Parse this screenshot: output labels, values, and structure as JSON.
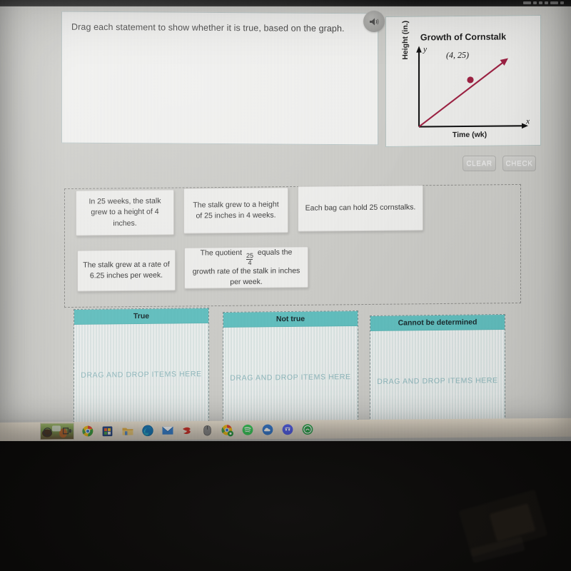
{
  "app": {
    "prompt": "Drag each statement to show whether it is true, based on the graph."
  },
  "audio": {
    "icon": "speaker-icon"
  },
  "graph": {
    "title": "Growth of Cornstalk",
    "x_axis_label": "Time (wk)",
    "y_axis_label": "Height (in.)",
    "x_axis_variable": "x",
    "y_axis_variable": "y",
    "point_label": "(4, 25)",
    "line_color": "#9e2042",
    "point_color": "#9e2042",
    "axis_color": "#111111"
  },
  "actions": {
    "clear_label": "CLEAR",
    "check_label": "CHECK"
  },
  "tiles": [
    {
      "id": "tile-1",
      "text": "In 25 weeks, the stalk grew to a height of 4 inches."
    },
    {
      "id": "tile-2",
      "text": "The stalk grew to a height of 25 inches in 4 weeks."
    },
    {
      "id": "tile-3",
      "text": "Each bag can hold 25 cornstalks."
    },
    {
      "id": "tile-4",
      "text": "The stalk grew at a rate of 6.25 inches per week."
    },
    {
      "id": "tile-5",
      "text_before": "The quotient",
      "fraction_numerator": "25",
      "fraction_denominator": "4",
      "text_after": "equals the growth rate of the stalk in inches per week."
    }
  ],
  "drop_zones": [
    {
      "id": "zone-true",
      "header": "True",
      "placeholder": "DRAG AND DROP ITEMS HERE"
    },
    {
      "id": "zone-not-true",
      "header": "Not true",
      "placeholder": "DRAG AND DROP ITEMS HERE"
    },
    {
      "id": "zone-cannot",
      "header": "Cannot be determined",
      "placeholder": "DRAG AND DROP ITEMS HERE"
    }
  ],
  "colors": {
    "zone_header": "#61c0c0",
    "page_background": "#cdcdc9",
    "panel_background": "#f2f2f0"
  },
  "taskbar": {
    "items": [
      {
        "name": "desktop-thumbnail-icon"
      },
      {
        "name": "cortana-search-icon"
      },
      {
        "name": "task-view-icon"
      },
      {
        "name": "google-chrome-icon"
      },
      {
        "name": "microsoft-store-icon"
      },
      {
        "name": "file-explorer-icon"
      },
      {
        "name": "microsoft-edge-icon"
      },
      {
        "name": "mail-icon"
      },
      {
        "name": "red-app-icon"
      },
      {
        "name": "mouse-settings-icon"
      },
      {
        "name": "chrome-badge-icon"
      },
      {
        "name": "spotify-icon"
      },
      {
        "name": "blue-cloud-icon"
      },
      {
        "name": "discord-icon"
      },
      {
        "name": "green-app-icon"
      }
    ]
  }
}
